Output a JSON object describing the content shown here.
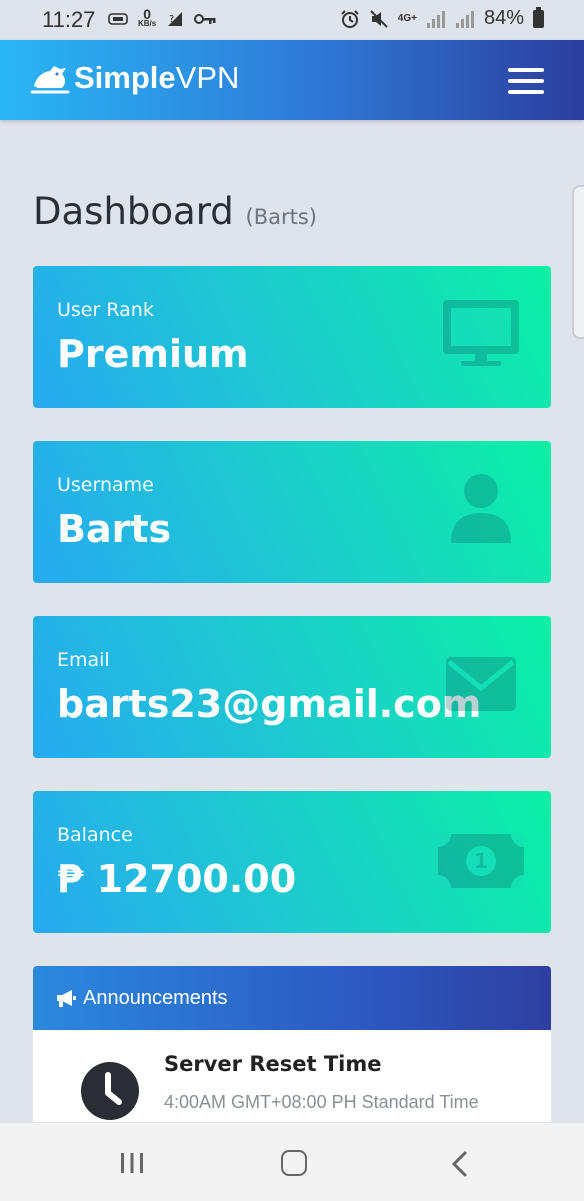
{
  "status_bar": {
    "time": "11:27",
    "net_speed_value": "0",
    "net_speed_unit": "KB/s",
    "network": "4G+",
    "battery": "84%"
  },
  "navbar": {
    "brand_bold": "Simple",
    "brand_light": "VPN"
  },
  "page": {
    "title": "Dashboard",
    "subtitle": "(Barts)"
  },
  "cards": [
    {
      "label": "User Rank",
      "value": "Premium",
      "icon": "monitor-icon"
    },
    {
      "label": "Username",
      "value": "Barts",
      "icon": "user-icon"
    },
    {
      "label": "Email",
      "value": "barts23@gmail.com",
      "icon": "envelope-icon"
    },
    {
      "label": "Balance",
      "value": "₱ 12700.00",
      "icon": "money-icon"
    }
  ],
  "announcements": {
    "header": "Announcements",
    "items": [
      {
        "title": "Server Reset Time",
        "subtitle": "4:00AM GMT+08:00 PH Standard Time"
      }
    ]
  },
  "colors": {
    "nav_start": "#29b6f6",
    "nav_end": "#2c3e9e",
    "card_start": "#27a9f1",
    "card_end": "#0bf0a4"
  }
}
